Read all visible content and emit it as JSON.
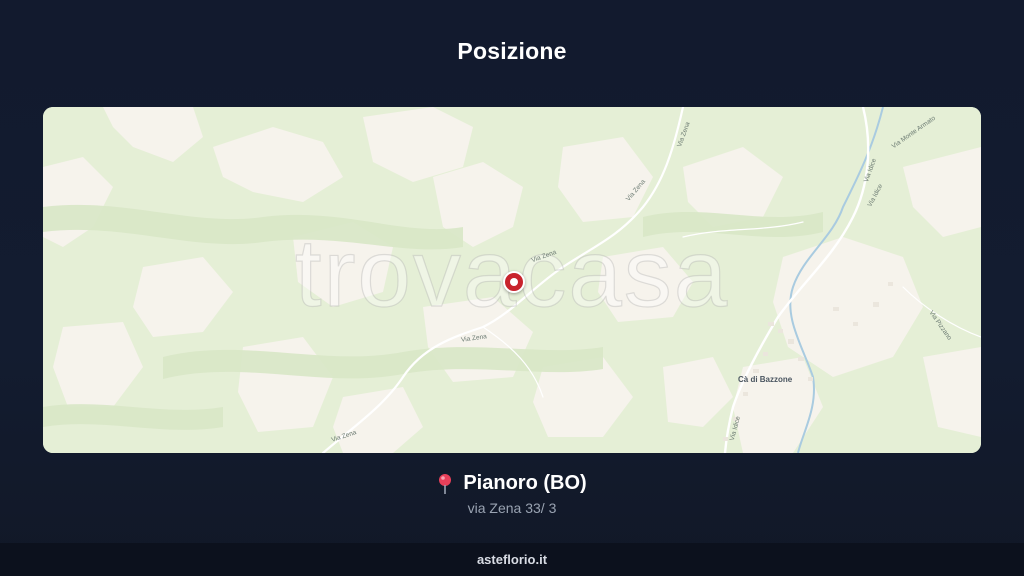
{
  "header": {
    "title": "Posizione"
  },
  "map": {
    "watermark": "trovacasa",
    "road_labels": [
      "Via Zena",
      "Via Zena",
      "Via Zena",
      "Via Zena",
      "Via Zena",
      "Via Idice",
      "Via Idice",
      "Via Idice",
      "Via Monte Armato",
      "Via Pizzano"
    ],
    "place_label": "Cà di Bazzone",
    "marker_icon": "location-marker-icon"
  },
  "location": {
    "pin_icon": "map-pin-icon",
    "city": "Pianoro (BO)",
    "address": "via Zena 33/ 3"
  },
  "footer": {
    "site": "asteflorio.it"
  }
}
